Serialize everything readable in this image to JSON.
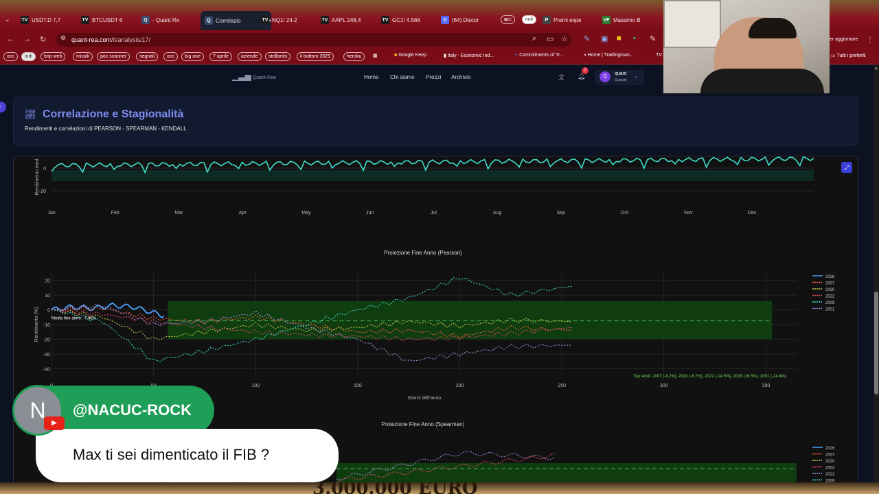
{
  "browser": {
    "tabs": [
      {
        "label": "USDT.D 7,7",
        "icon": "tradingview-icon",
        "icon_text": "TV",
        "color": "#1c1c1c"
      },
      {
        "label": "BTCUSDT 6",
        "icon": "tradingview-icon",
        "icon_text": "TV",
        "color": "#1c1c1c"
      },
      {
        "label": "- Quant Re",
        "icon": "quant-icon",
        "icon_text": "Q",
        "color": "#3a4a6a"
      },
      {
        "label": "Correlazio",
        "icon": "quant-icon",
        "icon_text": "Q",
        "color": "#3a4a6a"
      },
      {
        "label": "NQ1! 24.2",
        "icon": "tradingview-icon",
        "icon_text": "TV",
        "color": "#1c1c1c"
      },
      {
        "label": "AAPL 248,4",
        "icon": "tradingview-icon",
        "icon_text": "TV",
        "color": "#1c1c1c"
      },
      {
        "label": "GC1! 4.566",
        "icon": "tradingview-icon",
        "icon_text": "TV",
        "color": "#1c1c1c"
      },
      {
        "label": "(64) Discor",
        "icon": "discord-icon",
        "icon_text": "D",
        "color": "#5865f2"
      },
      {
        "label": "Premi espe",
        "icon": "generic-page-icon",
        "icon_text": "P",
        "color": "#444"
      },
      {
        "label": "Massimo B",
        "icon": "vf-icon",
        "icon_text": "VF",
        "color": "#2e7d32"
      }
    ],
    "tab_groups": [
      "occ",
      "indi"
    ],
    "address": {
      "domain": "quant-rea.com",
      "path": "/it/analysis/17/"
    },
    "update_label": "er aggiornare",
    "all_bookmarks": "Tutti i preferiti",
    "bookmarks_pills": [
      "occ",
      "indi",
      "bnp web",
      "missili",
      "poc scanner",
      "segnali",
      "occ",
      "big one",
      "7 aprile",
      "aziende",
      "stellantis",
      "il bottom 2025",
      "heroku"
    ],
    "bookmarks_links": [
      "Google Keep",
      "Italy - Economic Ind...",
      "Commitments of Tr...",
      "Home | Tradingman..."
    ]
  },
  "site": {
    "logo": "Quant-Rea",
    "nav": [
      "Home",
      "Chi siamo",
      "Prezzi",
      "Archivio"
    ],
    "notifications": "2",
    "user": {
      "initial": "Q",
      "name": "quant",
      "tier": "Gratuito"
    }
  },
  "header": {
    "title": "Correlazione e Stagionalità",
    "subtitle": "Rendimenti e correlazioni di PEARSON - SPEARMAN - KENDALL"
  },
  "chart_data": [
    {
      "type": "line",
      "title": "",
      "ylabel": "Rendimento med",
      "x": [
        "Jan",
        "Feb",
        "Mar",
        "Apr",
        "May",
        "Jun",
        "Jul",
        "Aug",
        "Sep",
        "Oct",
        "Nov",
        "Dec"
      ],
      "yticks": [
        0,
        -20
      ],
      "series": [
        {
          "values": [
            0,
            2,
            3,
            4,
            4,
            5,
            6,
            7,
            7,
            8,
            9,
            10
          ],
          "color": "#3fe0d0"
        }
      ]
    },
    {
      "type": "line",
      "title": "Proiezione Fine Anno (Pearson)",
      "xlabel": "Giorni dell'anno",
      "ylabel": "Rendimento (%)",
      "xticks": [
        0,
        50,
        100,
        150,
        200,
        250,
        300,
        350
      ],
      "yticks": [
        20,
        10,
        0,
        -10,
        -20,
        -30,
        -40
      ],
      "xlim": [
        0,
        365
      ],
      "ylim": [
        -45,
        25
      ],
      "band": [
        -20,
        6
      ],
      "mean_label": "Media fine anno: -7.48%",
      "mean_value": -7.48,
      "top_label": "Top simili: 2007 (-8.2%), 2020 (-6.7%), 2022 (-14.5%), 2009 (16.5%), 2001 (-24.4%)",
      "legend": [
        {
          "name": "2026",
          "color": "#4aa3ff"
        },
        {
          "name": "2007",
          "color": "#ff5a3c"
        },
        {
          "name": "2020",
          "color": "#c9c94a"
        },
        {
          "name": "2022",
          "color": "#e04a6a"
        },
        {
          "name": "2009",
          "color": "#3fe0d0"
        },
        {
          "name": "2001",
          "color": "#a08ad8"
        }
      ],
      "series": [
        {
          "name": "2026",
          "x": [
            0,
            10,
            20,
            30,
            40,
            50,
            55
          ],
          "values": [
            0,
            2,
            1,
            3,
            2,
            -2,
            -4
          ]
        },
        {
          "name": "2007",
          "x": [
            0,
            25,
            50,
            75,
            100,
            125,
            150,
            175,
            200,
            225,
            255
          ],
          "values": [
            0,
            1,
            -6,
            -8,
            -5,
            -10,
            -15,
            -14,
            -18,
            -12,
            -14
          ]
        },
        {
          "name": "2020",
          "x": [
            0,
            25,
            50,
            75,
            100,
            125,
            150,
            175,
            200,
            225,
            255
          ],
          "values": [
            0,
            -5,
            -20,
            -15,
            -10,
            -14,
            -12,
            -8,
            -11,
            -7,
            -8
          ]
        },
        {
          "name": "2022",
          "x": [
            0,
            25,
            50,
            75,
            100,
            125,
            150,
            175,
            200,
            225,
            255
          ],
          "values": [
            0,
            -3,
            -8,
            -12,
            -15,
            -17,
            -18,
            -20,
            -19,
            -16,
            -12
          ]
        },
        {
          "name": "2009",
          "x": [
            0,
            25,
            50,
            75,
            100,
            125,
            150,
            175,
            200,
            225,
            255
          ],
          "values": [
            0,
            -8,
            -35,
            -28,
            -20,
            -10,
            0,
            8,
            22,
            10,
            16
          ]
        },
        {
          "name": "2001",
          "x": [
            0,
            25,
            50,
            75,
            100,
            125,
            150,
            175,
            200,
            225,
            255
          ],
          "values": [
            0,
            3,
            -10,
            -8,
            -2,
            -12,
            -20,
            -35,
            -30,
            -25,
            -24
          ]
        }
      ]
    },
    {
      "type": "line",
      "title": "Proiezione Fine Anno (Spearman)",
      "legend": [
        {
          "name": "2026",
          "color": "#4aa3ff"
        },
        {
          "name": "2007",
          "color": "#ff5a3c"
        },
        {
          "name": "2020",
          "color": "#c9c94a"
        },
        {
          "name": "2003",
          "color": "#e04a6a"
        },
        {
          "name": "2022",
          "color": "#a08ad8"
        },
        {
          "name": "2009",
          "color": "#3fe0d0"
        }
      ]
    }
  ],
  "overlay": {
    "name": "@NACUC-ROCK",
    "initial": "N",
    "message": "Max ti sei dimenticato il FIB ?",
    "poster_text": "3.000.000 EURO"
  }
}
